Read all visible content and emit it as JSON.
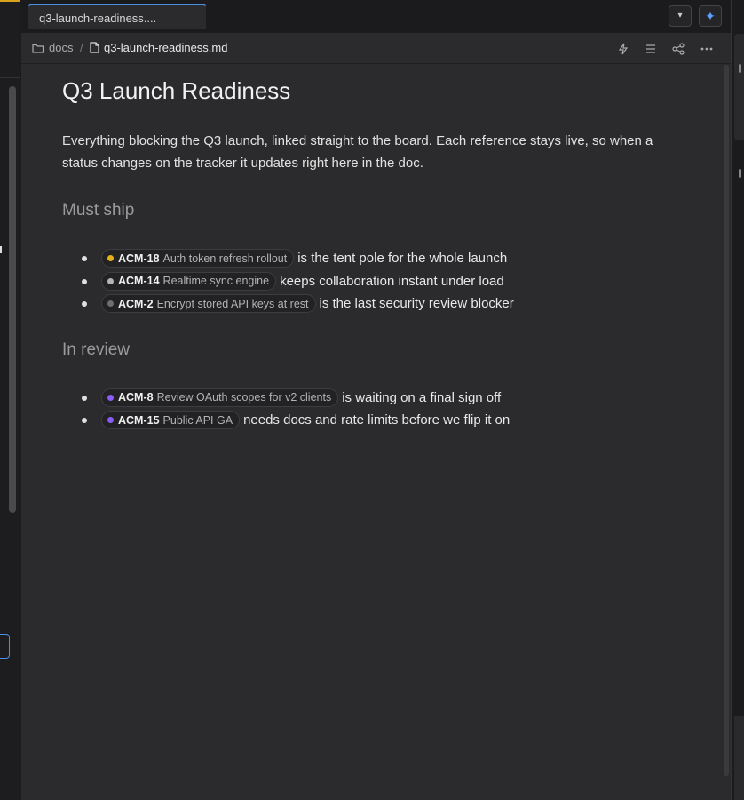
{
  "tab": {
    "label": "q3-launch-readiness...."
  },
  "breadcrumb": {
    "folder": "docs",
    "separator": "/",
    "file": "q3-launch-readiness.md"
  },
  "icons": {
    "folder": "folder-icon",
    "file": "file-icon",
    "action1": "lightning-icon",
    "action2": "list-icon",
    "action3": "share-icon",
    "action4": "more-icon",
    "tab_menu": "chevron-down-icon",
    "ai": "sparkle-icon"
  },
  "doc": {
    "title": "Q3 Launch Readiness",
    "intro": "Everything blocking the Q3 launch, linked straight to the board. Each reference stays live, so when a status changes on the tracker it updates right here in the doc.",
    "sections": [
      {
        "heading": "Must ship",
        "items": [
          {
            "key": "ACM-18",
            "title": "Auth token refresh rollout",
            "status_color": "#e5b019",
            "text": "is the tent pole for the whole launch"
          },
          {
            "key": "ACM-14",
            "title": "Realtime sync engine",
            "status_color": "#b4b4b4",
            "text": "keeps collaboration instant under load"
          },
          {
            "key": "ACM-2",
            "title": "Encrypt stored API keys at rest",
            "status_color": "#6e6e6e",
            "text": "is the last security review blocker"
          }
        ]
      },
      {
        "heading": "In review",
        "items": [
          {
            "key": "ACM-8",
            "title": "Review OAuth scopes for v2 clients",
            "status_color": "#8b5cf6",
            "text": "is waiting on a final sign off"
          },
          {
            "key": "ACM-15",
            "title": "Public API GA",
            "status_color": "#8b5cf6",
            "text": "needs docs and rate limits before we flip it on"
          }
        ]
      }
    ]
  }
}
